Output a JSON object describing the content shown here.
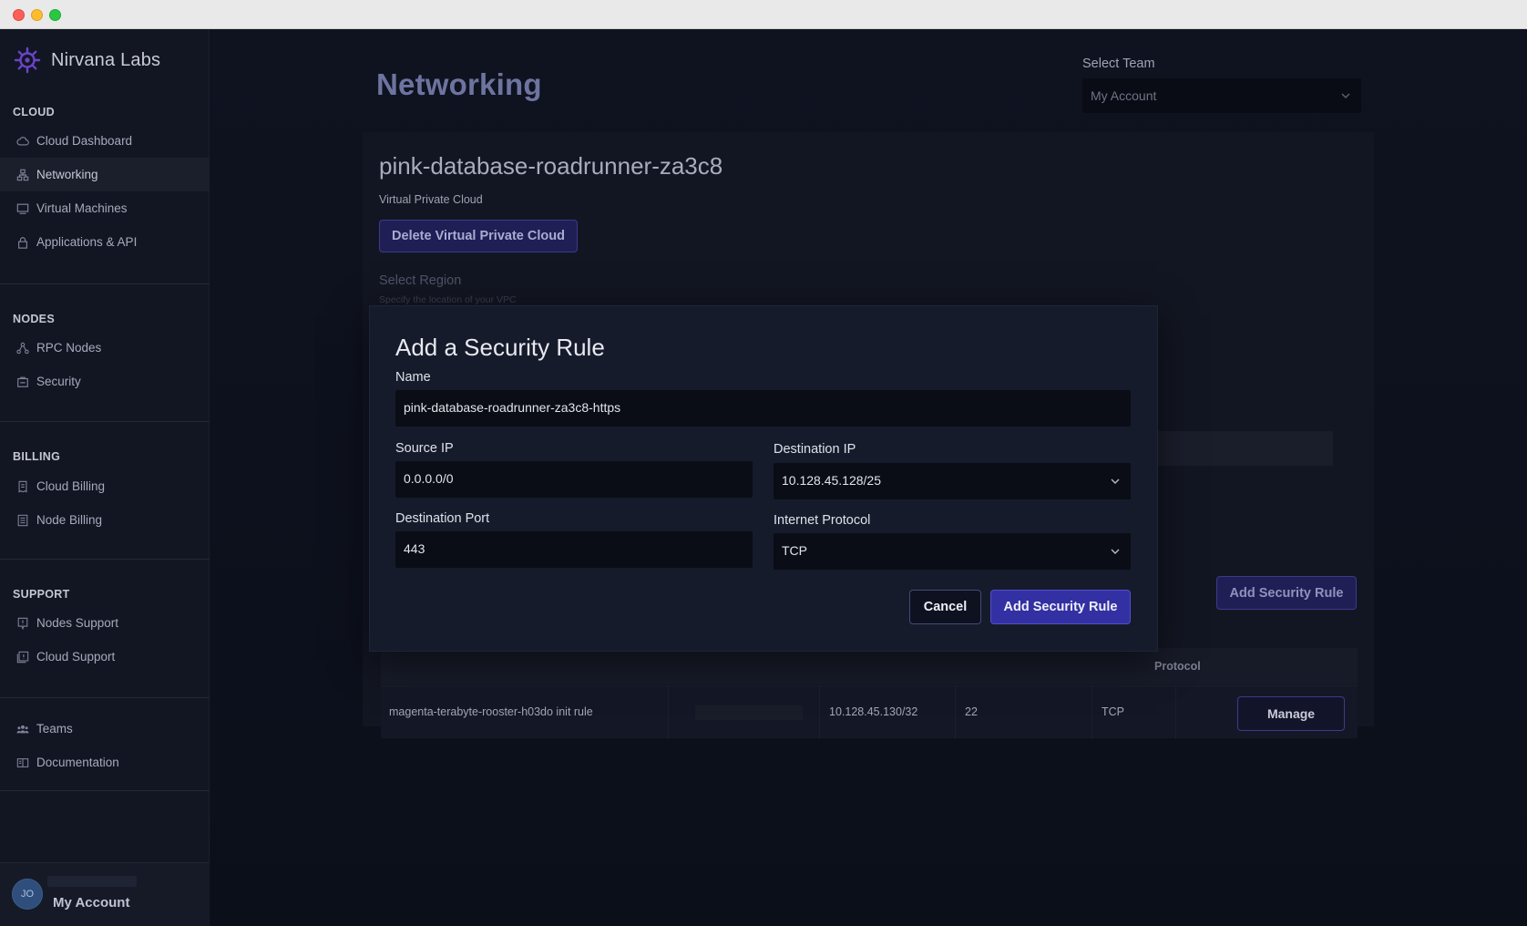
{
  "brand": {
    "name": "Nirvana Labs",
    "logo_icon": "nirvana-logo-icon"
  },
  "sidebar": {
    "sections": [
      {
        "label": "CLOUD",
        "items": [
          {
            "label": "Cloud Dashboard",
            "icon": "cloud-icon"
          },
          {
            "label": "Networking",
            "icon": "network-icon",
            "active": true
          },
          {
            "label": "Virtual Machines",
            "icon": "monitor-icon"
          },
          {
            "label": "Applications & API",
            "icon": "lock-icon"
          }
        ]
      },
      {
        "label": "NODES",
        "items": [
          {
            "label": "RPC Nodes",
            "icon": "nodes-icon"
          },
          {
            "label": "Security",
            "icon": "shield-icon"
          }
        ]
      },
      {
        "label": "BILLING",
        "items": [
          {
            "label": "Cloud Billing",
            "icon": "receipt-icon"
          },
          {
            "label": "Node Billing",
            "icon": "invoice-icon"
          }
        ]
      },
      {
        "label": "SUPPORT",
        "items": [
          {
            "label": "Nodes Support",
            "icon": "support-icon"
          },
          {
            "label": "Cloud Support",
            "icon": "help-icon"
          }
        ]
      },
      {
        "label": "",
        "items": [
          {
            "label": "Teams",
            "icon": "team-icon"
          },
          {
            "label": "Documentation",
            "icon": "book-icon"
          }
        ]
      }
    ]
  },
  "account": {
    "initials": "JO",
    "name": "My Account"
  },
  "header": {
    "title": "Networking",
    "team_label": "Select Team",
    "team_value": "My Account"
  },
  "vpc": {
    "name": "pink-database-roadrunner-za3c8",
    "type_label": "Virtual Private Cloud",
    "delete_label": "Delete Virtual Private Cloud",
    "region_label": "Select Region",
    "region_hint": "Specify the location of your VPC",
    "add_rule_label": "Add Security Rule"
  },
  "rules_table": {
    "protocol_header": "Protocol",
    "rows": [
      {
        "name": "magenta-terabyte-rooster-h03do init rule",
        "destination_ip": "10.128.45.130/32",
        "port": "22",
        "protocol": "TCP",
        "action_label": "Manage"
      }
    ]
  },
  "modal": {
    "title": "Add a Security Rule",
    "name_label": "Name",
    "name_value": "pink-database-roadrunner-za3c8-https",
    "source_ip_label": "Source IP",
    "source_ip_value": "0.0.0.0/0",
    "destination_ip_label": "Destination IP",
    "destination_ip_value": "10.128.45.128/25",
    "destination_port_label": "Destination Port",
    "destination_port_value": "443",
    "protocol_label": "Internet Protocol",
    "protocol_value": "TCP",
    "cancel_label": "Cancel",
    "submit_label": "Add Security Rule"
  },
  "colors": {
    "accent": "#3330a3",
    "background": "#0d111c",
    "sidebar": "#121623",
    "modal": "#161b2b"
  }
}
